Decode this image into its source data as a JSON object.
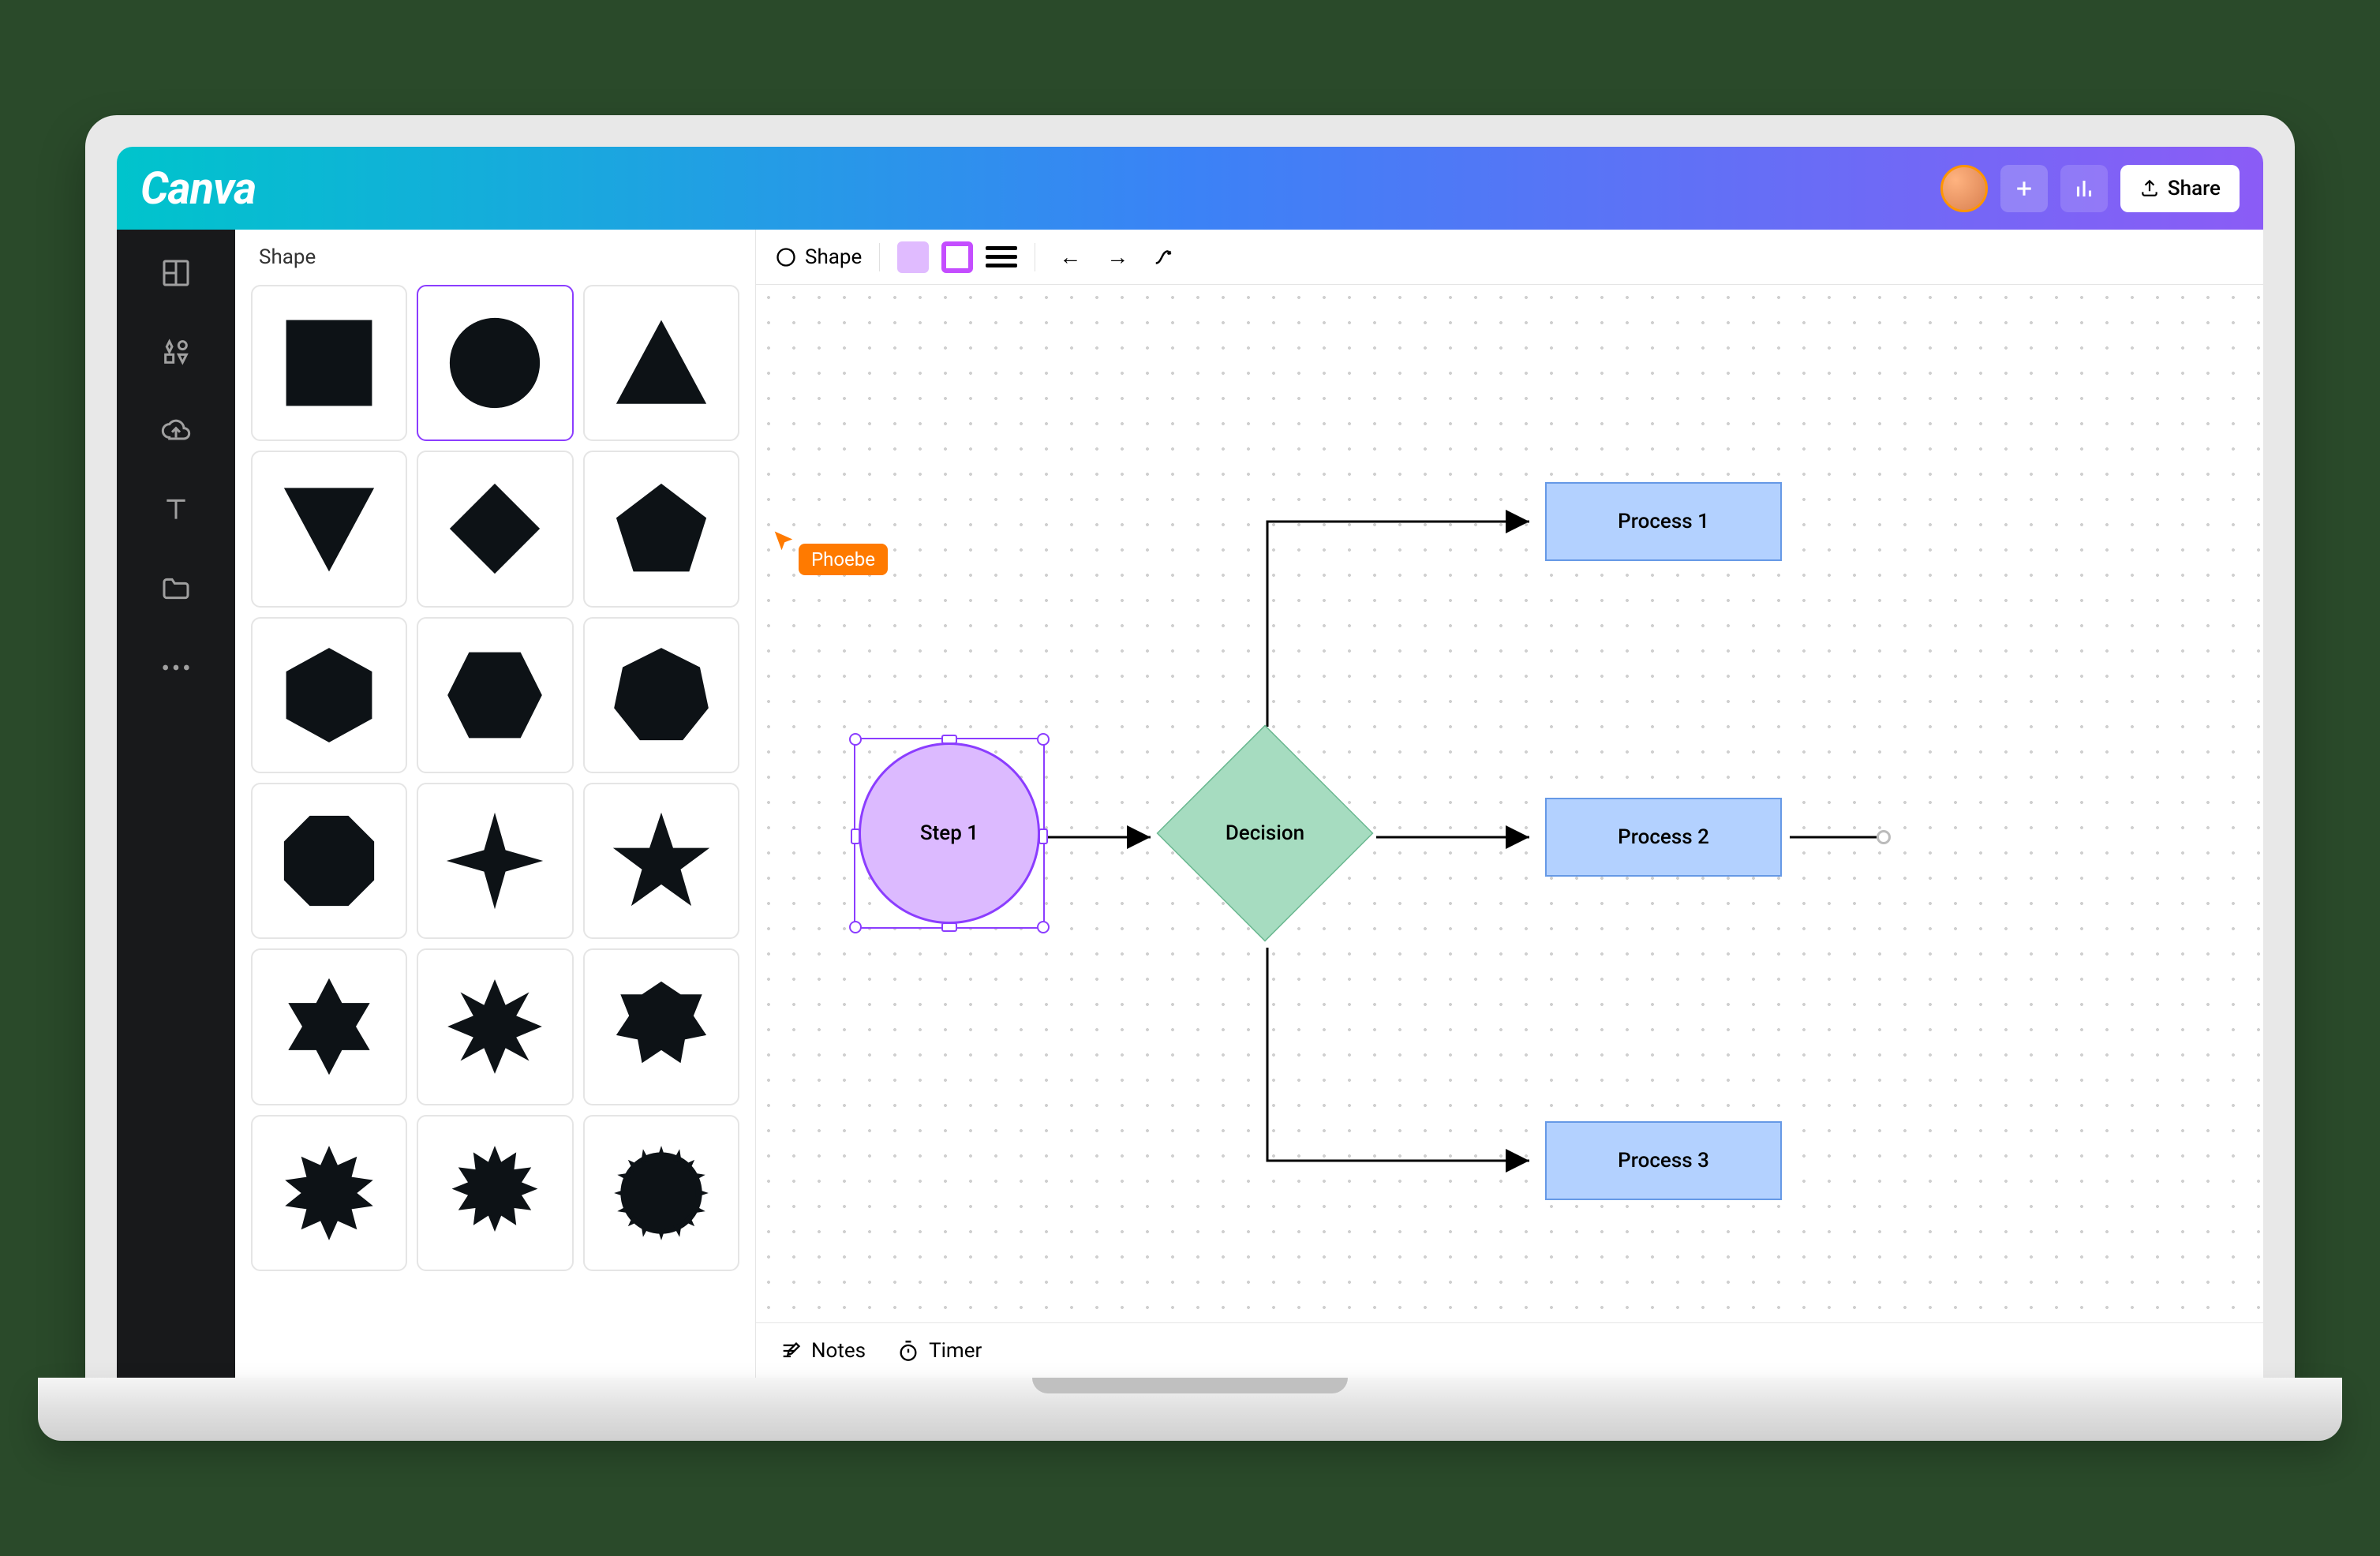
{
  "app": {
    "name": "Canva"
  },
  "topbar": {
    "share_label": "Share"
  },
  "leftbar": {
    "items": [
      "templates",
      "elements",
      "uploads",
      "text",
      "projects",
      "more"
    ]
  },
  "shapes_panel": {
    "title": "Shape",
    "shapes": [
      "square",
      "circle",
      "triangle",
      "triangle-down",
      "diamond",
      "pentagon",
      "hexagon",
      "hexagon-h",
      "octagon",
      "rounded-octagon",
      "star-4",
      "star-5",
      "star-6",
      "star-8",
      "badge",
      "burst-16",
      "burst-20",
      "burst-24"
    ],
    "selected_index": 1
  },
  "context_toolbar": {
    "label": "Shape",
    "fill_color": "#e0bbff",
    "border_color": "#c44dff"
  },
  "collab": {
    "user_name": "Phoebe",
    "color": "#ff7a00"
  },
  "flowchart": {
    "step_label": "Step 1",
    "decision_label": "Decision",
    "processes": [
      "Process 1",
      "Process 2",
      "Process 3"
    ]
  },
  "bottom_bar": {
    "notes_label": "Notes",
    "timer_label": "Timer"
  }
}
